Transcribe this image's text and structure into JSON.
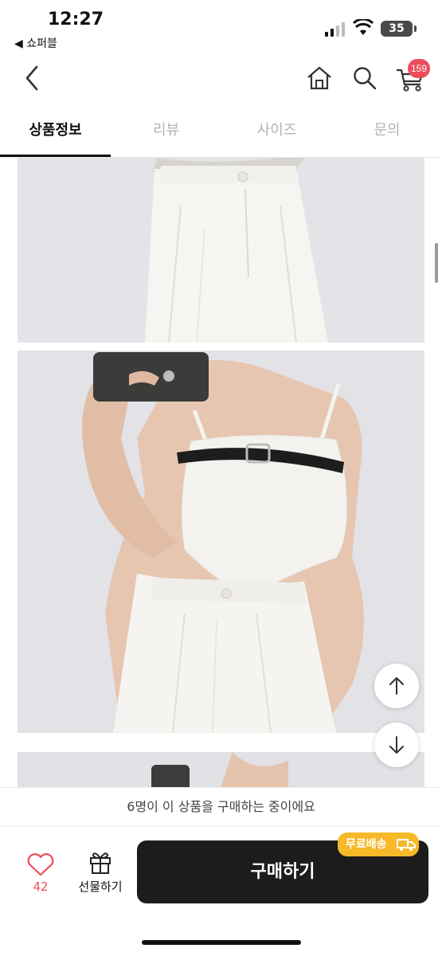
{
  "status_bar": {
    "time": "12:27",
    "back_app": "◀ 쇼퍼블",
    "battery": "35"
  },
  "header": {
    "cart_count": "159",
    "icons": [
      "back-chevron-icon",
      "home-icon",
      "search-icon",
      "cart-icon"
    ]
  },
  "tabs": [
    {
      "label": "상품정보",
      "active": true
    },
    {
      "label": "리뷰",
      "active": false
    },
    {
      "label": "사이즈",
      "active": false
    },
    {
      "label": "문의",
      "active": false
    }
  ],
  "buying_notice": "6명이 이 상품을 구매하는 중이에요",
  "actions": {
    "like_count": "42",
    "gift_label": "선물하기",
    "buy_label": "구매하기",
    "free_shipping_label": "무료배송"
  },
  "colors": {
    "accent": "#ec4c5c",
    "buy_button": "#1c1c1c",
    "free_shipping": "#f7b928"
  }
}
